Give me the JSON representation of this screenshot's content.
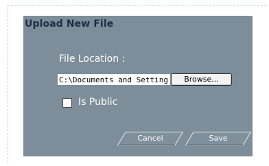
{
  "panel": {
    "title": "Upload New File"
  },
  "file_location": {
    "label": "File Location :",
    "value": "C:\\Documents and Settings\\",
    "browse_label": "Browse..."
  },
  "is_public": {
    "label": "Is Public",
    "checked": false
  },
  "actions": {
    "cancel_label": "Cancel",
    "save_label": "Save"
  }
}
